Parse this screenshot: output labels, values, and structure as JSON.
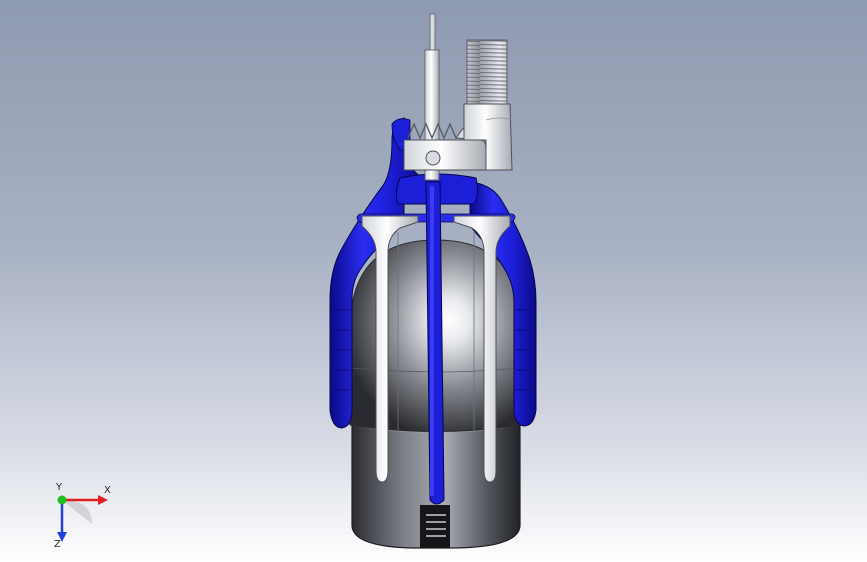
{
  "viewport": {
    "background_top": "#8e9ab0",
    "background_bottom": "#ffffff"
  },
  "model": {
    "colors": {
      "housing_blue": "#1d1ed8",
      "housing_blue_dark": "#0b0b8a",
      "metal_light": "#f2f4f7",
      "metal_mid": "#b8bcc4",
      "metal_dark": "#4d5058",
      "sphere_highlight": "#ffffff",
      "sphere_dark": "#2c2c2c"
    }
  },
  "triad": {
    "x_label": "X",
    "y_label": "Y",
    "z_label": "Z",
    "x_color": "#e02020",
    "y_color": "#20c020",
    "z_color": "#2040e0"
  }
}
